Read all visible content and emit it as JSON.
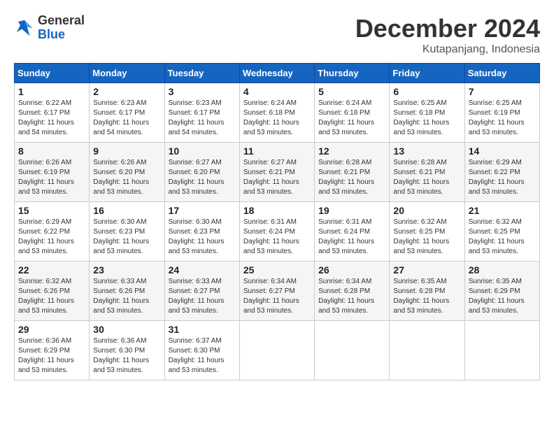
{
  "logo": {
    "general": "General",
    "blue": "Blue"
  },
  "title": "December 2024",
  "location": "Kutapanjang, Indonesia",
  "weekdays": [
    "Sunday",
    "Monday",
    "Tuesday",
    "Wednesday",
    "Thursday",
    "Friday",
    "Saturday"
  ],
  "weeks": [
    [
      {
        "day": "1",
        "sunrise": "6:22 AM",
        "sunset": "6:17 PM",
        "daylight": "11 hours and 54 minutes."
      },
      {
        "day": "2",
        "sunrise": "6:23 AM",
        "sunset": "6:17 PM",
        "daylight": "11 hours and 54 minutes."
      },
      {
        "day": "3",
        "sunrise": "6:23 AM",
        "sunset": "6:17 PM",
        "daylight": "11 hours and 54 minutes."
      },
      {
        "day": "4",
        "sunrise": "6:24 AM",
        "sunset": "6:18 PM",
        "daylight": "11 hours and 53 minutes."
      },
      {
        "day": "5",
        "sunrise": "6:24 AM",
        "sunset": "6:18 PM",
        "daylight": "11 hours and 53 minutes."
      },
      {
        "day": "6",
        "sunrise": "6:25 AM",
        "sunset": "6:18 PM",
        "daylight": "11 hours and 53 minutes."
      },
      {
        "day": "7",
        "sunrise": "6:25 AM",
        "sunset": "6:19 PM",
        "daylight": "11 hours and 53 minutes."
      }
    ],
    [
      {
        "day": "8",
        "sunrise": "6:26 AM",
        "sunset": "6:19 PM",
        "daylight": "11 hours and 53 minutes."
      },
      {
        "day": "9",
        "sunrise": "6:26 AM",
        "sunset": "6:20 PM",
        "daylight": "11 hours and 53 minutes."
      },
      {
        "day": "10",
        "sunrise": "6:27 AM",
        "sunset": "6:20 PM",
        "daylight": "11 hours and 53 minutes."
      },
      {
        "day": "11",
        "sunrise": "6:27 AM",
        "sunset": "6:21 PM",
        "daylight": "11 hours and 53 minutes."
      },
      {
        "day": "12",
        "sunrise": "6:28 AM",
        "sunset": "6:21 PM",
        "daylight": "11 hours and 53 minutes."
      },
      {
        "day": "13",
        "sunrise": "6:28 AM",
        "sunset": "6:21 PM",
        "daylight": "11 hours and 53 minutes."
      },
      {
        "day": "14",
        "sunrise": "6:29 AM",
        "sunset": "6:22 PM",
        "daylight": "11 hours and 53 minutes."
      }
    ],
    [
      {
        "day": "15",
        "sunrise": "6:29 AM",
        "sunset": "6:22 PM",
        "daylight": "11 hours and 53 minutes."
      },
      {
        "day": "16",
        "sunrise": "6:30 AM",
        "sunset": "6:23 PM",
        "daylight": "11 hours and 53 minutes."
      },
      {
        "day": "17",
        "sunrise": "6:30 AM",
        "sunset": "6:23 PM",
        "daylight": "11 hours and 53 minutes."
      },
      {
        "day": "18",
        "sunrise": "6:31 AM",
        "sunset": "6:24 PM",
        "daylight": "11 hours and 53 minutes."
      },
      {
        "day": "19",
        "sunrise": "6:31 AM",
        "sunset": "6:24 PM",
        "daylight": "11 hours and 53 minutes."
      },
      {
        "day": "20",
        "sunrise": "6:32 AM",
        "sunset": "6:25 PM",
        "daylight": "11 hours and 53 minutes."
      },
      {
        "day": "21",
        "sunrise": "6:32 AM",
        "sunset": "6:25 PM",
        "daylight": "11 hours and 53 minutes."
      }
    ],
    [
      {
        "day": "22",
        "sunrise": "6:32 AM",
        "sunset": "6:26 PM",
        "daylight": "11 hours and 53 minutes."
      },
      {
        "day": "23",
        "sunrise": "6:33 AM",
        "sunset": "6:26 PM",
        "daylight": "11 hours and 53 minutes."
      },
      {
        "day": "24",
        "sunrise": "6:33 AM",
        "sunset": "6:27 PM",
        "daylight": "11 hours and 53 minutes."
      },
      {
        "day": "25",
        "sunrise": "6:34 AM",
        "sunset": "6:27 PM",
        "daylight": "11 hours and 53 minutes."
      },
      {
        "day": "26",
        "sunrise": "6:34 AM",
        "sunset": "6:28 PM",
        "daylight": "11 hours and 53 minutes."
      },
      {
        "day": "27",
        "sunrise": "6:35 AM",
        "sunset": "6:28 PM",
        "daylight": "11 hours and 53 minutes."
      },
      {
        "day": "28",
        "sunrise": "6:35 AM",
        "sunset": "6:29 PM",
        "daylight": "11 hours and 53 minutes."
      }
    ],
    [
      {
        "day": "29",
        "sunrise": "6:36 AM",
        "sunset": "6:29 PM",
        "daylight": "11 hours and 53 minutes."
      },
      {
        "day": "30",
        "sunrise": "6:36 AM",
        "sunset": "6:30 PM",
        "daylight": "11 hours and 53 minutes."
      },
      {
        "day": "31",
        "sunrise": "6:37 AM",
        "sunset": "6:30 PM",
        "daylight": "11 hours and 53 minutes."
      },
      null,
      null,
      null,
      null
    ]
  ]
}
